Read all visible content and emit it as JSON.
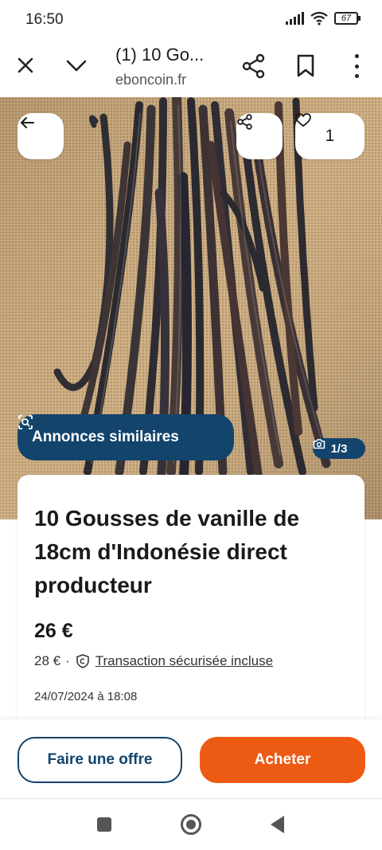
{
  "status_bar": {
    "time": "16:50",
    "battery": "67",
    "icons": [
      "signal-icon",
      "wifi-icon",
      "battery-icon"
    ]
  },
  "browser": {
    "title": "(1) 10 Go...",
    "url": "eboncoin.fr",
    "icons": [
      "close-icon",
      "chevron-down-icon",
      "share-icon",
      "bookmark-icon",
      "more-vert-icon"
    ]
  },
  "hero": {
    "like_count": "1",
    "similar_label": "Annonces similaires",
    "photo_counter": "1/3",
    "icons": [
      "back-arrow-icon",
      "share-icon",
      "heart-icon",
      "similar-search-icon",
      "camera-icon"
    ]
  },
  "listing": {
    "title": "10 Gousses de vanille de 18cm d'Indonésie direct producteur",
    "price": "26 €",
    "total_price": "28 €",
    "separator": "·",
    "secure_label": "Transaction sécurisée incluse",
    "date": "24/07/2024 à 18:08"
  },
  "actions": {
    "offer_label": "Faire une offre",
    "buy_label": "Acheter"
  },
  "colors": {
    "brand_blue": "#13446c",
    "buy_orange": "#ec5a13"
  }
}
